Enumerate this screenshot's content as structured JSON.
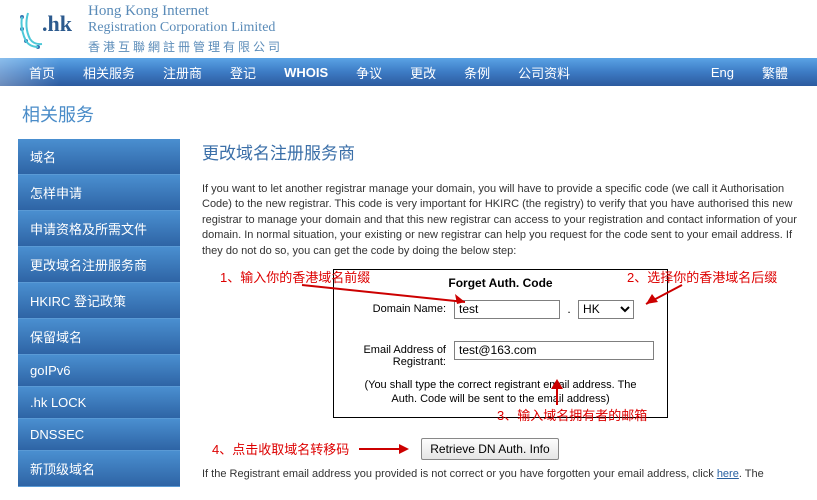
{
  "company": {
    "logo_text": ".hk",
    "name_en1": "Hong Kong Internet",
    "name_en2": "Registration Corporation Limited",
    "name_zh": "香港互聯網註冊管理有限公司"
  },
  "nav": {
    "items": [
      "首页",
      "相关服务",
      "注册商",
      "登记",
      "WHOIS",
      "争议",
      "更改",
      "条例",
      "公司资料"
    ],
    "lang": [
      "Eng",
      "繁體"
    ]
  },
  "section_title": "相关服务",
  "sidebar": {
    "items": [
      "域名",
      "怎样申请",
      "申请资格及所需文件",
      "更改域名注册服务商",
      "HKIRC 登记政策",
      "保留域名",
      "goIPv6",
      ".hk LOCK",
      "DNSSEC",
      "新顶级域名"
    ]
  },
  "content": {
    "title": "更改域名注册服务商",
    "intro": "If you want to let another registrar manage your domain, you will have to provide a specific code (we call it Authorisation Code) to the new registrar. This code is very important for HKIRC (the registry) to verify that you have authorised this new registrar to manage your domain and that this new registrar can access to your registration and contact information of your domain. In normal situation, your existing or new registrar can help you request for the code sent to your email address. If they do not do so, you can get the code by doing the below step:"
  },
  "form": {
    "title": "Forget Auth. Code",
    "domain_label": "Domain Name:",
    "domain_value": "test",
    "tld_value": "HK",
    "email_label": "Email Address of Registrant:",
    "email_value": "test@163.com",
    "note": "(You shall type the correct registrant email address. The Auth. Code will be sent to the email address)",
    "retrieve_btn": "Retrieve DN Auth. Info"
  },
  "annotations": {
    "a1": "1、输入你的香港域名前缀",
    "a2": "2、选择你的香港域名后缀",
    "a3": "3、输入域名拥有者的邮箱",
    "a4": "4、点击收取域名转移码"
  },
  "footer": {
    "text_before": "If the Registrant email address you provided is not correct or you have forgotten your email address, click ",
    "link": "here",
    "text_after": ". The"
  }
}
